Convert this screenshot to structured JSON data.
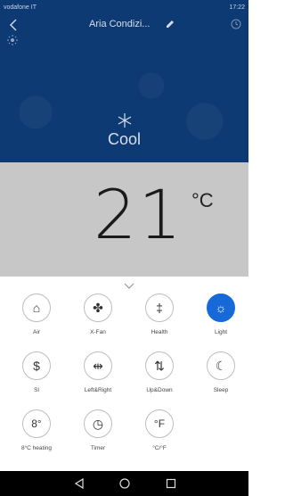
{
  "status_bar": {
    "left": "vodafone IT",
    "right": "17:22"
  },
  "header": {
    "title": "Aria Condizi...",
    "mode": "Cool"
  },
  "temperature": {
    "value": "21",
    "unit": "°C"
  },
  "features": [
    {
      "label": "Air",
      "icon": "air-icon",
      "glyph": "⌂"
    },
    {
      "label": "X-Fan",
      "icon": "fan-icon",
      "glyph": "✤"
    },
    {
      "label": "Health",
      "icon": "health-icon",
      "glyph": "‡"
    },
    {
      "label": "Light",
      "icon": "light-icon",
      "glyph": "☼",
      "active": true
    },
    {
      "label": "Sl",
      "icon": "dollar-icon",
      "glyph": "$"
    },
    {
      "label": "Left&Right",
      "icon": "swing-horizontal-icon",
      "glyph": "⇹"
    },
    {
      "label": "Up&Down",
      "icon": "swing-vertical-icon",
      "glyph": "⇅"
    },
    {
      "label": "Sleep",
      "icon": "sleep-icon",
      "glyph": "☾"
    },
    {
      "label": "8°C heating",
      "icon": "heating-8c-icon",
      "glyph": "8°"
    },
    {
      "label": "Timer",
      "icon": "timer-icon",
      "glyph": "◷"
    },
    {
      "label": "°C/°F",
      "icon": "unit-toggle-icon",
      "glyph": "°F"
    }
  ],
  "colors": {
    "header_bg": "#0e3a73",
    "temp_panel_bg": "#c7c7c7",
    "active": "#1769d9"
  }
}
